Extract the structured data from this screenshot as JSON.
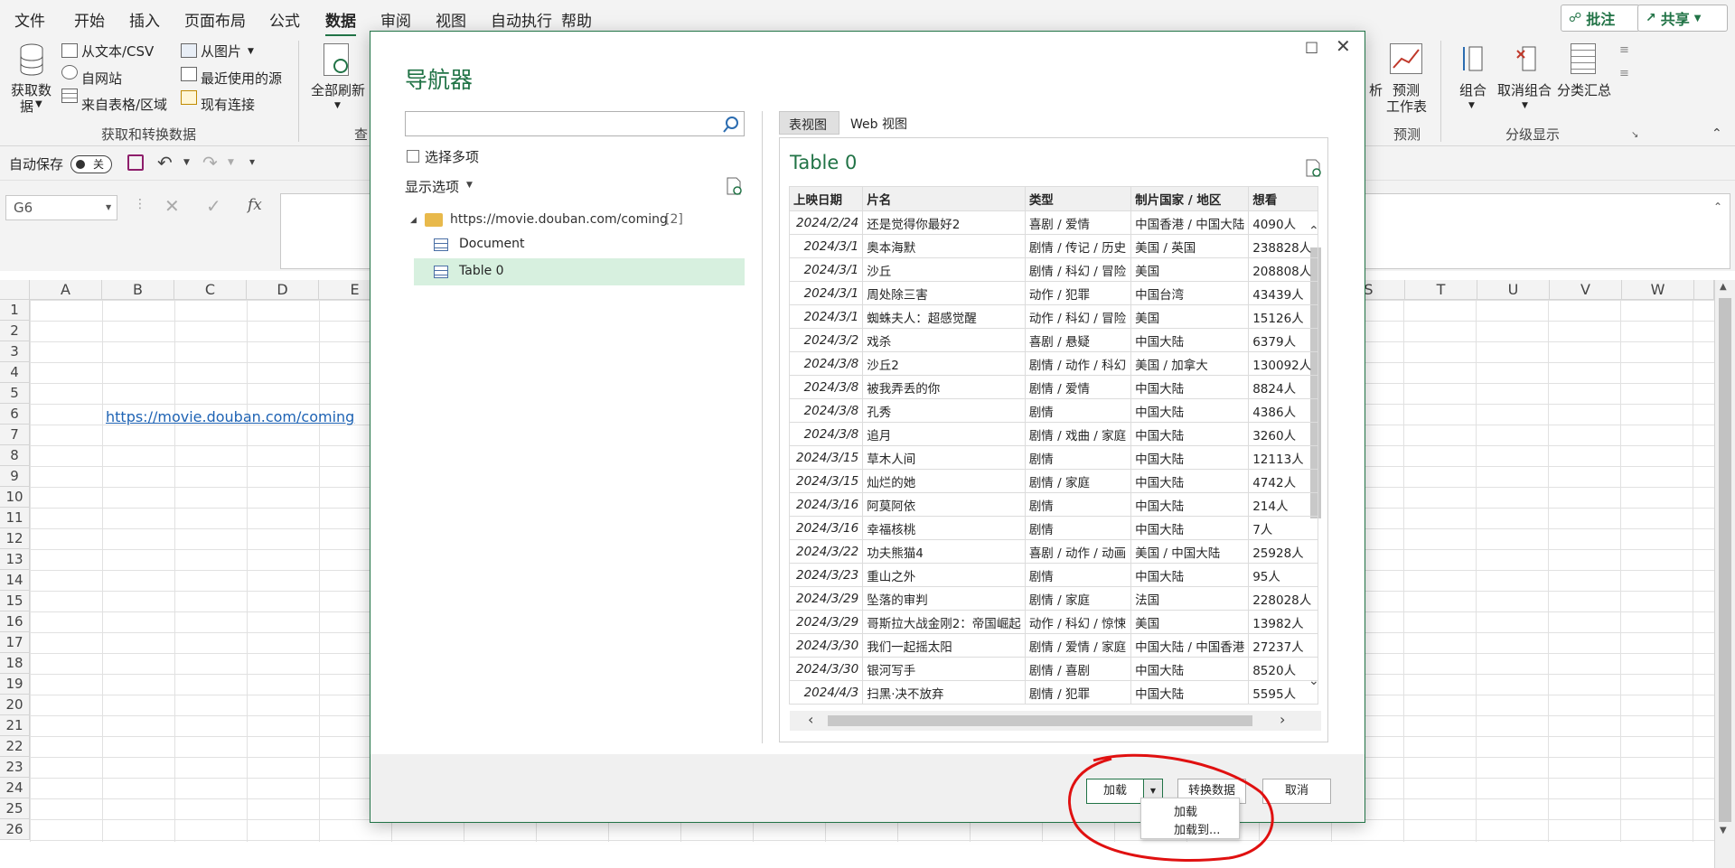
{
  "ribbon_tabs": [
    "文件",
    "开始",
    "插入",
    "页面布局",
    "公式",
    "数据",
    "审阅",
    "视图",
    "自动执行",
    "帮助"
  ],
  "active_tab": "数据",
  "top_buttons": {
    "comment": "批注",
    "share": "共享"
  },
  "ribbon": {
    "get_data": "获取数\n据",
    "get_data_line1": "获取数",
    "get_data_line2": "据",
    "from_text_csv": "从文本/CSV",
    "from_web": "自网站",
    "from_table": "来自表格/区域",
    "from_picture": "从图片",
    "recent_sources": "最近使用的源",
    "existing_connections": "现有连接",
    "group_get_transform": "获取和转换数据",
    "refresh_all": "全部刷新",
    "query_group_partial": "查",
    "analysis_partial": "析",
    "forecast_sheet_line1": "预测",
    "forecast_sheet_line2": "工作表",
    "forecast_group": "预测",
    "group": "组合",
    "ungroup": "取消组合",
    "subtotal": "分类汇总",
    "outline_group": "分级显示"
  },
  "qat": {
    "autosave": "自动保存",
    "autosave_state": "关"
  },
  "formula_bar": {
    "name_box": "G6",
    "fx": "fx"
  },
  "columns_left": [
    "A",
    "B",
    "C",
    "D",
    "E"
  ],
  "columns_right": [
    "S",
    "T",
    "U",
    "V",
    "W"
  ],
  "rows": [
    "1",
    "2",
    "3",
    "4",
    "5",
    "6",
    "7",
    "8",
    "9",
    "10",
    "11",
    "12",
    "13",
    "14",
    "15",
    "16",
    "17",
    "18",
    "19",
    "20",
    "21",
    "22",
    "23",
    "24",
    "25",
    "26"
  ],
  "cell_b6": "https://movie.douban.com/coming",
  "navigator": {
    "title": "导航器",
    "search_placeholder": "",
    "select_multiple": "选择多项",
    "display_options": "显示选项",
    "tree_root": "https://movie.douban.com/coming",
    "tree_root_count": "[2]",
    "tree_items": [
      "Document",
      "Table 0"
    ],
    "selected_item": "Table 0",
    "view_tabs": [
      "表视图",
      "Web 视图"
    ],
    "preview_title": "Table 0",
    "table": {
      "headers": [
        "上映日期",
        "片名",
        "类型",
        "制片国家 / 地区",
        "想看"
      ],
      "rows": [
        [
          "2024/2/24",
          "还是觉得你最好2",
          "喜剧 / 爱情",
          "中国香港 / 中国大陆",
          "4090人"
        ],
        [
          "2024/3/1",
          "奥本海默",
          "剧情 / 传记 / 历史",
          "美国 / 英国",
          "238828人"
        ],
        [
          "2024/3/1",
          "沙丘",
          "剧情 / 科幻 / 冒险",
          "美国",
          "208808人"
        ],
        [
          "2024/3/1",
          "周处除三害",
          "动作 / 犯罪",
          "中国台湾",
          "43439人"
        ],
        [
          "2024/3/1",
          "蜘蛛夫人：超感觉醒",
          "动作 / 科幻 / 冒险",
          "美国",
          "15126人"
        ],
        [
          "2024/3/2",
          "戏杀",
          "喜剧 / 悬疑",
          "中国大陆",
          "6379人"
        ],
        [
          "2024/3/8",
          "沙丘2",
          "剧情 / 动作 / 科幻",
          "美国 / 加拿大",
          "130092人"
        ],
        [
          "2024/3/8",
          "被我弄丢的你",
          "剧情 / 爱情",
          "中国大陆",
          "8824人"
        ],
        [
          "2024/3/8",
          "孔秀",
          "剧情",
          "中国大陆",
          "4386人"
        ],
        [
          "2024/3/8",
          "追月",
          "剧情 / 戏曲 / 家庭",
          "中国大陆",
          "3260人"
        ],
        [
          "2024/3/15",
          "草木人间",
          "剧情",
          "中国大陆",
          "12113人"
        ],
        [
          "2024/3/15",
          "灿烂的她",
          "剧情 / 家庭",
          "中国大陆",
          "4742人"
        ],
        [
          "2024/3/16",
          "阿莫阿依",
          "剧情",
          "中国大陆",
          "214人"
        ],
        [
          "2024/3/16",
          "幸福核桃",
          "剧情",
          "中国大陆",
          "7人"
        ],
        [
          "2024/3/22",
          "功夫熊猫4",
          "喜剧 / 动作 / 动画",
          "美国 / 中国大陆",
          "25928人"
        ],
        [
          "2024/3/23",
          "重山之外",
          "剧情",
          "中国大陆",
          "95人"
        ],
        [
          "2024/3/29",
          "坠落的审判",
          "剧情 / 家庭",
          "法国",
          "228028人"
        ],
        [
          "2024/3/29",
          "哥斯拉大战金刚2：帝国崛起",
          "动作 / 科幻 / 惊悚",
          "美国",
          "13982人"
        ],
        [
          "2024/3/30",
          "我们一起摇太阳",
          "剧情 / 爱情 / 家庭",
          "中国大陆 / 中国香港",
          "27237人"
        ],
        [
          "2024/3/30",
          "银河写手",
          "剧情 / 喜剧",
          "中国大陆",
          "8520人"
        ],
        [
          "2024/4/3",
          "扫黑·决不放弃",
          "剧情 / 犯罪",
          "中国大陆",
          "5595人"
        ]
      ]
    },
    "buttons": {
      "load": "加载",
      "transform": "转换数据",
      "cancel": "取消"
    },
    "load_menu": [
      "加载",
      "加载到..."
    ]
  },
  "colors": {
    "accent": "#217346",
    "highlight": "#d7f0df",
    "annotation": "#e01010"
  }
}
